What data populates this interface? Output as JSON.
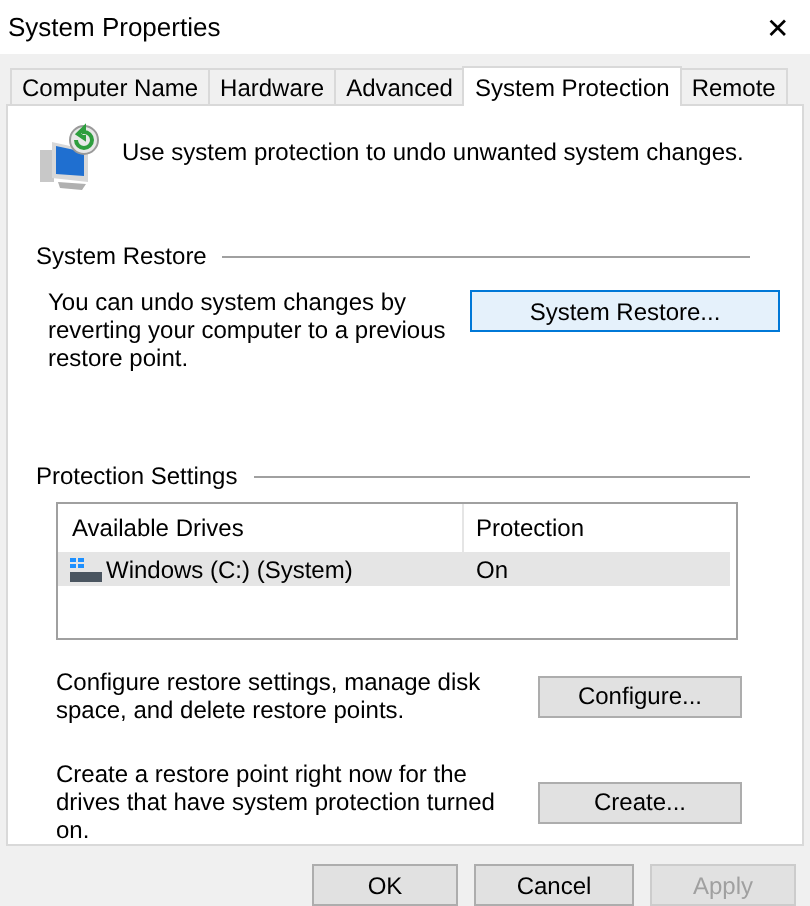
{
  "window": {
    "title": "System Properties",
    "close": "✕"
  },
  "tabs": [
    {
      "label": "Computer Name",
      "selected": false
    },
    {
      "label": "Hardware",
      "selected": false
    },
    {
      "label": "Advanced",
      "selected": false
    },
    {
      "label": "System Protection",
      "selected": true
    },
    {
      "label": "Remote",
      "selected": false
    }
  ],
  "intro": "Use system protection to undo unwanted system changes.",
  "system_restore": {
    "heading": "System Restore",
    "text": "You can undo system changes by reverting your computer to a previous restore point.",
    "button": "System Restore..."
  },
  "protection_settings": {
    "heading": "Protection Settings",
    "columns": [
      "Available Drives",
      "Protection"
    ],
    "rows": [
      {
        "drive": "Windows (C:) (System)",
        "protection": "On",
        "selected": true
      }
    ],
    "actions": [
      {
        "text": "Configure restore settings, manage disk space, and delete restore points.",
        "button": "Configure..."
      },
      {
        "text": "Create a restore point right now for the drives that have system protection turned on.",
        "button": "Create..."
      }
    ]
  },
  "buttons": [
    {
      "label": "OK",
      "disabled": false
    },
    {
      "label": "Cancel",
      "disabled": false
    },
    {
      "label": "Apply",
      "disabled": true
    }
  ]
}
